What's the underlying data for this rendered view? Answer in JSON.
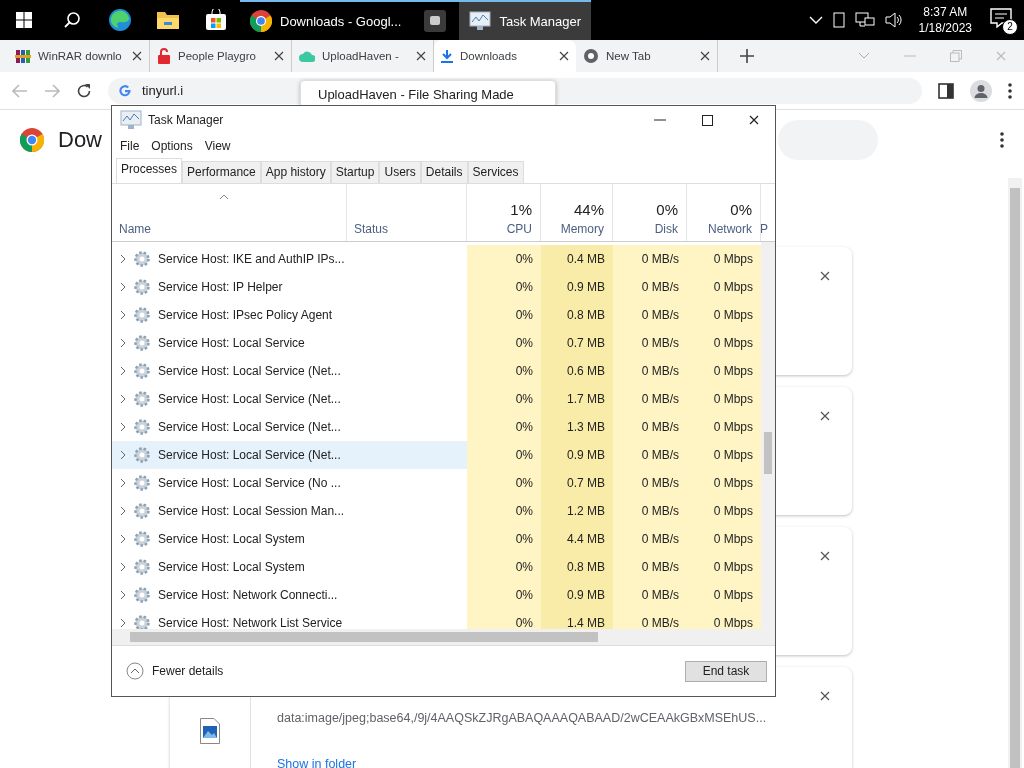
{
  "taskbar": {
    "apps": [
      {
        "kind": "chrome",
        "label": "Downloads - Googl...",
        "selected": false
      },
      {
        "kind": "generic",
        "selected": false
      },
      {
        "kind": "taskmgr",
        "label": "Task Manager",
        "selected": true
      }
    ],
    "clock": {
      "time": "8:37 AM",
      "date": "1/18/2023"
    },
    "notifications": "2"
  },
  "browser": {
    "tabs": [
      {
        "kind": "winrar",
        "title": "WinRAR downlo",
        "selected": false
      },
      {
        "kind": "lock",
        "title": "People Playgro",
        "selected": false
      },
      {
        "kind": "cloud",
        "title": "UploadHaven -",
        "selected": false
      },
      {
        "kind": "download",
        "title": "Downloads",
        "selected": true
      },
      {
        "kind": "chrome",
        "title": "New Tab",
        "selected": false
      }
    ],
    "address": "tinyurl.i",
    "tooltip": "UploadHaven - File Sharing Made",
    "page": {
      "title": "Dow",
      "cards": [
        {
          "kind": "blank"
        },
        {
          "kind": "blank"
        },
        {
          "kind": "blank"
        },
        {
          "kind": "file",
          "url": "data:image/jpeg;base64,/9j/4AAQSkZJRgABAQAAAQABAAD/2wCEAAkGBxMSEhUS...",
          "link": "Show in folder"
        }
      ]
    }
  },
  "task_manager": {
    "title": "Task Manager",
    "menu": [
      "File",
      "Options",
      "View"
    ],
    "tabs": [
      {
        "label": "Processes",
        "selected": true
      },
      {
        "label": "Performance",
        "selected": false
      },
      {
        "label": "App history",
        "selected": false
      },
      {
        "label": "Startup",
        "selected": false
      },
      {
        "label": "Users",
        "selected": false
      },
      {
        "label": "Details",
        "selected": false
      },
      {
        "label": "Services",
        "selected": false
      }
    ],
    "columns": [
      {
        "label": "Name"
      },
      {
        "label": "Status"
      },
      {
        "label": "CPU",
        "percent": "1%"
      },
      {
        "label": "Memory",
        "percent": "44%"
      },
      {
        "label": "Disk",
        "percent": "0%"
      },
      {
        "label": "Network",
        "percent": "0%"
      },
      {
        "label": "P"
      }
    ],
    "rows": [
      {
        "name": "Service Host: IKE and AuthIP IPs...",
        "cpu": "0%",
        "memory": "0.4 MB",
        "disk": "0 MB/s",
        "network": "0 Mbps",
        "selected": false
      },
      {
        "name": "Service Host: IP Helper",
        "cpu": "0%",
        "memory": "0.9 MB",
        "disk": "0 MB/s",
        "network": "0 Mbps",
        "selected": false
      },
      {
        "name": "Service Host: IPsec Policy Agent",
        "cpu": "0%",
        "memory": "0.8 MB",
        "disk": "0 MB/s",
        "network": "0 Mbps",
        "selected": false
      },
      {
        "name": "Service Host: Local Service",
        "cpu": "0%",
        "memory": "0.7 MB",
        "disk": "0 MB/s",
        "network": "0 Mbps",
        "selected": false
      },
      {
        "name": "Service Host: Local Service (Net...",
        "cpu": "0%",
        "memory": "0.6 MB",
        "disk": "0 MB/s",
        "network": "0 Mbps",
        "selected": false
      },
      {
        "name": "Service Host: Local Service (Net...",
        "cpu": "0%",
        "memory": "1.7 MB",
        "disk": "0 MB/s",
        "network": "0 Mbps",
        "selected": false
      },
      {
        "name": "Service Host: Local Service (Net...",
        "cpu": "0%",
        "memory": "1.3 MB",
        "disk": "0 MB/s",
        "network": "0 Mbps",
        "selected": false
      },
      {
        "name": "Service Host: Local Service (Net...",
        "cpu": "0%",
        "memory": "0.9 MB",
        "disk": "0 MB/s",
        "network": "0 Mbps",
        "selected": true
      },
      {
        "name": "Service Host: Local Service (No ...",
        "cpu": "0%",
        "memory": "0.7 MB",
        "disk": "0 MB/s",
        "network": "0 Mbps",
        "selected": false
      },
      {
        "name": "Service Host: Local Session Man...",
        "cpu": "0%",
        "memory": "1.2 MB",
        "disk": "0 MB/s",
        "network": "0 Mbps",
        "selected": false
      },
      {
        "name": "Service Host: Local System",
        "cpu": "0%",
        "memory": "4.4 MB",
        "disk": "0 MB/s",
        "network": "0 Mbps",
        "selected": false
      },
      {
        "name": "Service Host: Local System",
        "cpu": "0%",
        "memory": "0.8 MB",
        "disk": "0 MB/s",
        "network": "0 Mbps",
        "selected": false
      },
      {
        "name": "Service Host: Network Connecti...",
        "cpu": "0%",
        "memory": "0.9 MB",
        "disk": "0 MB/s",
        "network": "0 Mbps",
        "selected": false
      },
      {
        "name": "Service Host: Network List Service",
        "cpu": "0%",
        "memory": "1.4 MB",
        "disk": "0 MB/s",
        "network": "0 Mbps",
        "selected": false
      }
    ],
    "fewer_details": "Fewer details",
    "end_task": "End task"
  }
}
